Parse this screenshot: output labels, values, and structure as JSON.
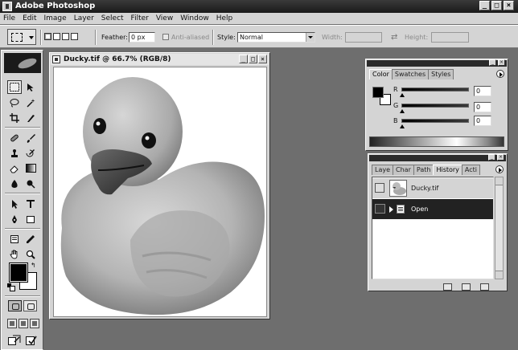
{
  "app": {
    "title": "Adobe Photoshop"
  },
  "window_controls": {
    "minimize": "_",
    "maximize": "□",
    "close": "×"
  },
  "menu": [
    "File",
    "Edit",
    "Image",
    "Layer",
    "Select",
    "Filter",
    "View",
    "Window",
    "Help"
  ],
  "options": {
    "feather_label": "Feather:",
    "feather_value": "0 px",
    "antialiased_label": "Anti-aliased",
    "style_label": "Style:",
    "style_value": "Normal",
    "width_label": "Width:",
    "height_label": "Height:"
  },
  "document": {
    "title": "Ducky.tif @ 66.7% (RGB/8)"
  },
  "color_panel": {
    "tabs": [
      "Color",
      "Swatches",
      "Styles"
    ],
    "active_tab": "Color",
    "channels": [
      {
        "label": "R",
        "value": "0"
      },
      {
        "label": "G",
        "value": "0"
      },
      {
        "label": "B",
        "value": "0"
      }
    ]
  },
  "history_panel": {
    "tabs": [
      "Layers",
      "Channels",
      "Paths",
      "History",
      "Actions"
    ],
    "tab_labels": [
      "Laye",
      "Char",
      "Path",
      "History",
      "Acti"
    ],
    "active_tab": "History",
    "snapshot_name": "Ducky.tif",
    "states": [
      "Open"
    ]
  },
  "colors": {
    "foreground": "#000000",
    "background": "#ffffff",
    "workspace": "#6e6e6e"
  },
  "icons": {
    "tools": [
      "marquee-tool",
      "move-tool",
      "lasso-tool",
      "magic-wand-tool",
      "crop-tool",
      "slice-tool",
      "healing-brush-tool",
      "brush-tool",
      "clone-stamp-tool",
      "history-brush-tool",
      "eraser-tool",
      "gradient-tool",
      "blur-tool",
      "dodge-tool",
      "path-selection-tool",
      "type-tool",
      "pen-tool",
      "shape-tool",
      "notes-tool",
      "eyedropper-tool",
      "hand-tool",
      "zoom-tool"
    ]
  }
}
